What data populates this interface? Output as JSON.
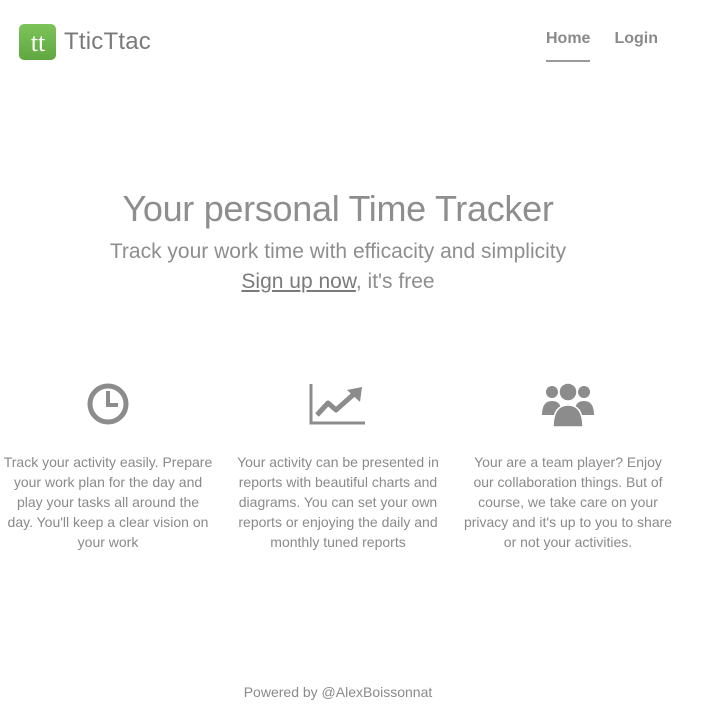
{
  "brand": {
    "name": "TticTtac",
    "logo_letters": "tt",
    "logo_color": "#6cb64b"
  },
  "nav": {
    "items": [
      {
        "label": "Home",
        "active": true
      },
      {
        "label": "Login",
        "active": false
      }
    ]
  },
  "hero": {
    "title": "Your personal Time Tracker",
    "subtitle": "Track your work time with efficacity and simplicity",
    "cta_link": "Sign up now",
    "cta_rest": ", it's free"
  },
  "features": [
    {
      "icon": "clock-icon",
      "text": "Track your activity easily. Prepare your work plan for the day and play your tasks all around the day. You'll keep a clear vision on your work"
    },
    {
      "icon": "chart-icon",
      "text": "Your activity can be presented in reports with beautiful charts and diagrams. You can set your own reports or enjoying the daily and monthly tuned reports"
    },
    {
      "icon": "team-icon",
      "text": "Your are a team player? Enjoy our collaboration things. But of course, we take care on your privacy and it's up to you to share or not your activities."
    }
  ],
  "footer": {
    "text": "Powered by @AlexBoissonnat"
  }
}
